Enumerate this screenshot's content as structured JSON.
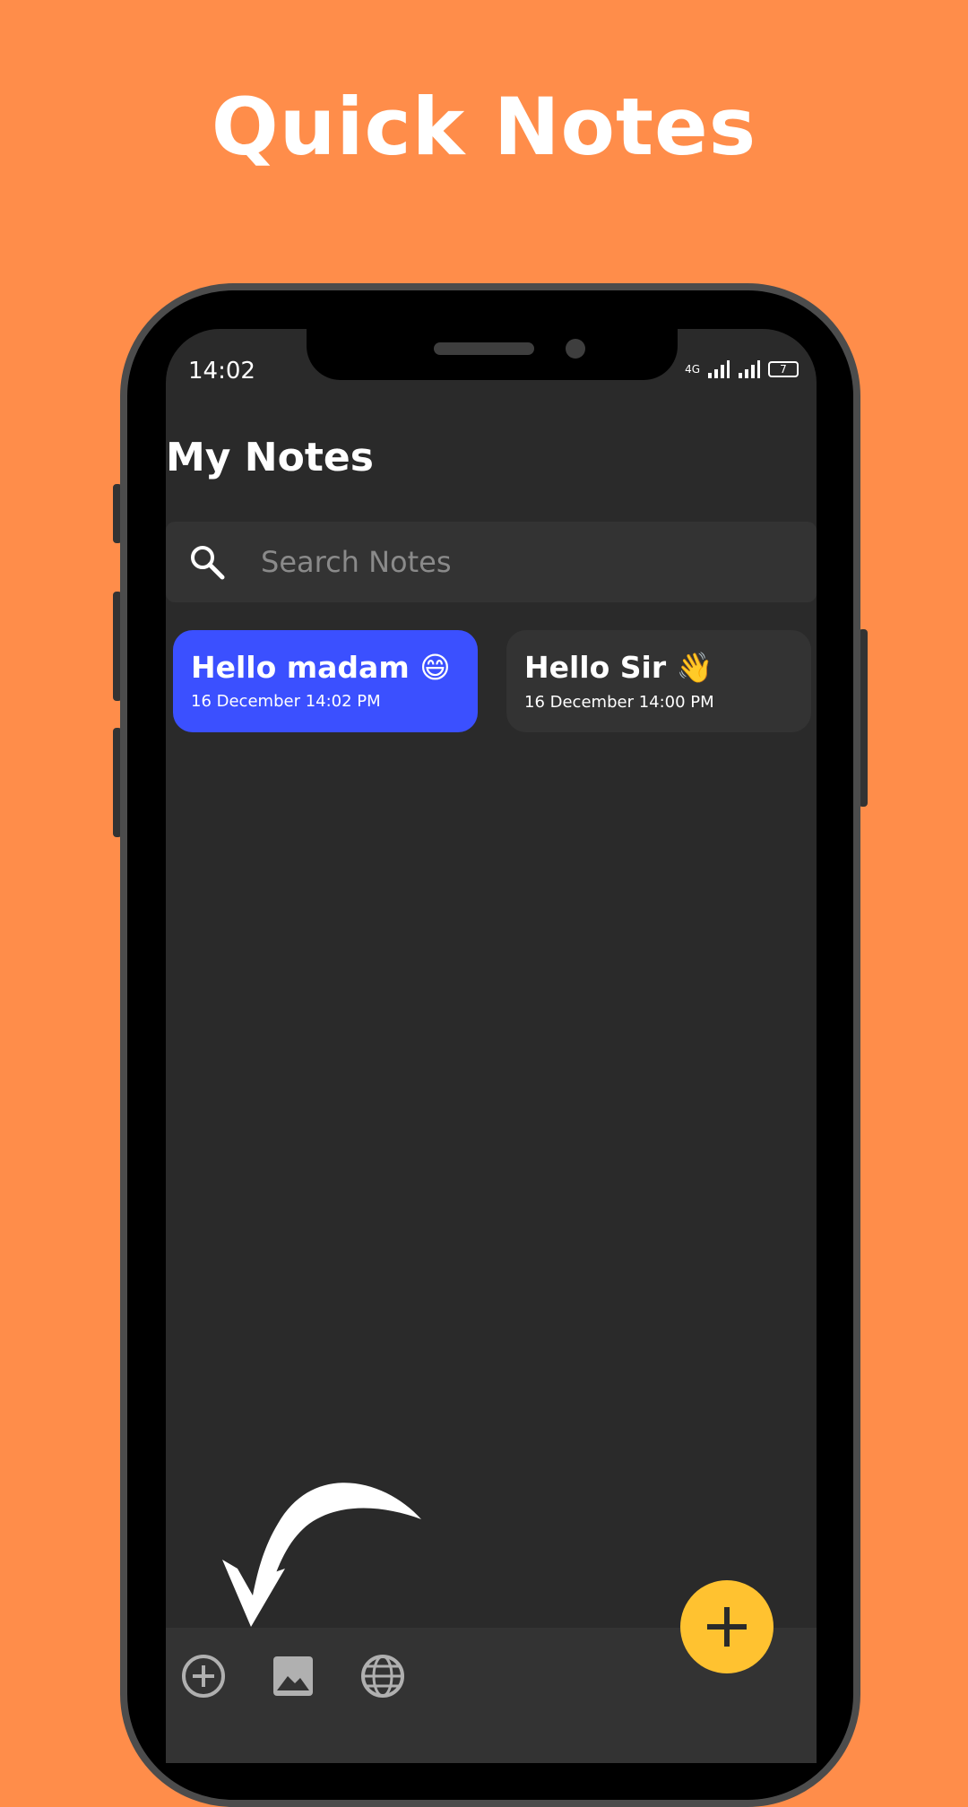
{
  "promo": {
    "headline": "Quick Notes"
  },
  "status_bar": {
    "time": "14:02",
    "network_label": "4G",
    "battery": "7"
  },
  "header": {
    "title": "My Notes"
  },
  "search": {
    "placeholder": "Search Notes"
  },
  "notes": [
    {
      "title": "Hello madam 😄",
      "date": "16 December 14:02 PM",
      "color": "#3B50FF"
    },
    {
      "title": "Hello Sir 👋",
      "date": "16 December 14:00 PM",
      "color": "#333333"
    }
  ],
  "bottom_bar": {
    "icons": [
      "add-circle-icon",
      "image-icon",
      "globe-icon"
    ]
  },
  "fab": {
    "icon": "plus-icon",
    "color": "#FFC230"
  },
  "colors": {
    "background": "#FF8D4A",
    "screen": "#2A2A2A",
    "surface": "#333333",
    "accent": "#3B50FF"
  }
}
